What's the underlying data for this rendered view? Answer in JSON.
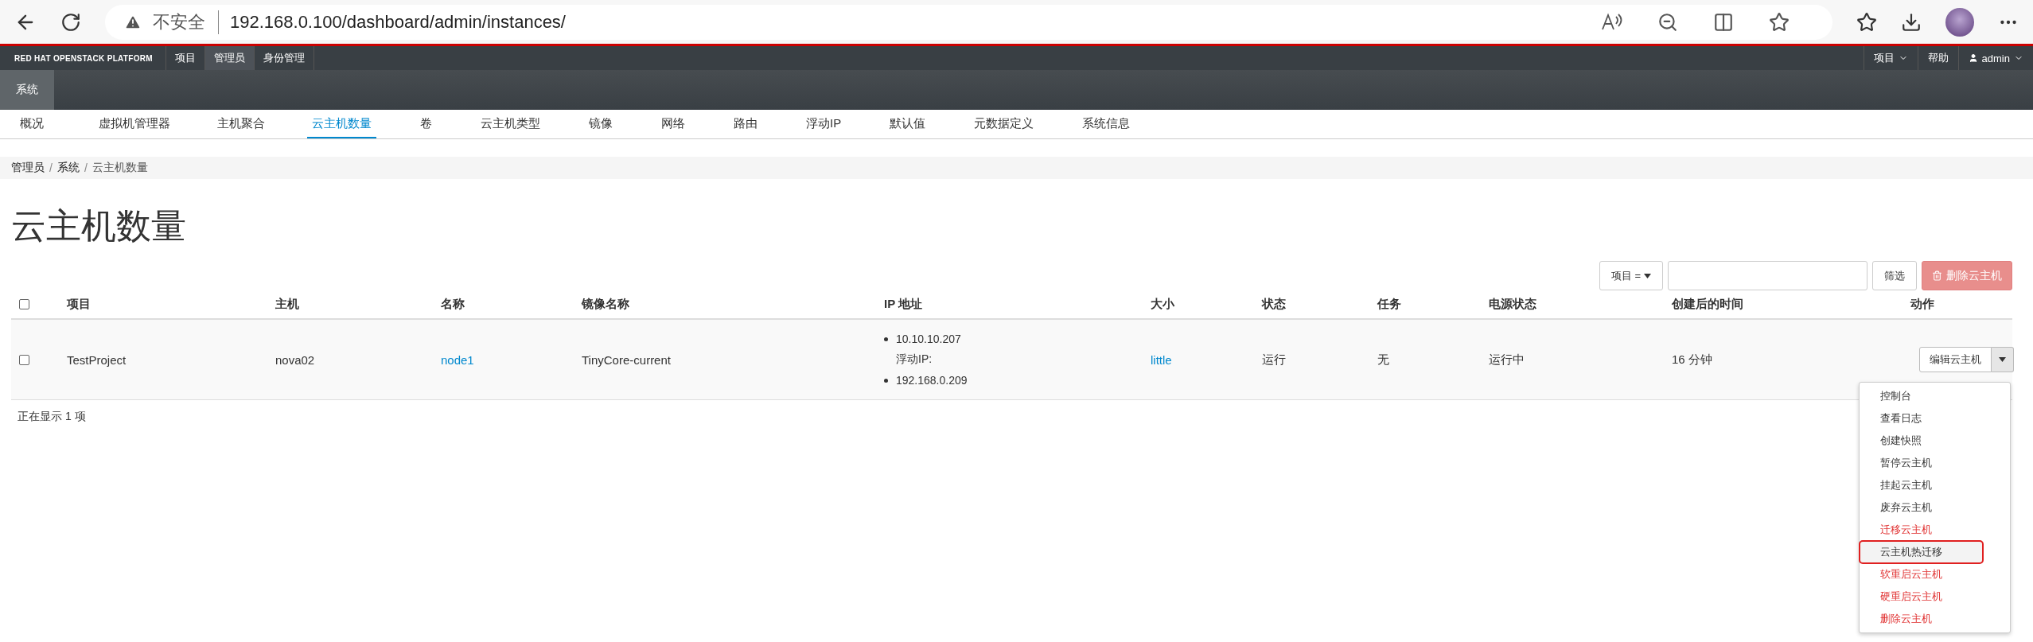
{
  "browser": {
    "security": "不安全",
    "url": "192.168.0.100/dashboard/admin/instances/"
  },
  "top_nav": {
    "logo": "RED HAT OPENSTACK PLATFORM",
    "tabs": [
      {
        "label": "项目",
        "selected": false
      },
      {
        "label": "管理员",
        "selected": true
      },
      {
        "label": "身份管理",
        "selected": false
      }
    ],
    "right": [
      {
        "label": "项目",
        "kind": "dropdown"
      },
      {
        "label": "帮助",
        "kind": "link"
      },
      {
        "label": "admin",
        "kind": "user"
      }
    ]
  },
  "section_tabs": [
    {
      "label": "系统",
      "selected": true
    }
  ],
  "sub_nav": [
    {
      "label": "概况",
      "selected": false
    },
    {
      "label": "虚拟机管理器",
      "selected": false
    },
    {
      "label": "主机聚合",
      "selected": false
    },
    {
      "label": "云主机数量",
      "selected": true
    },
    {
      "label": "卷",
      "selected": false
    },
    {
      "label": "云主机类型",
      "selected": false
    },
    {
      "label": "镜像",
      "selected": false
    },
    {
      "label": "网络",
      "selected": false
    },
    {
      "label": "路由",
      "selected": false
    },
    {
      "label": "浮动IP",
      "selected": false
    },
    {
      "label": "默认值",
      "selected": false
    },
    {
      "label": "元数据定义",
      "selected": false
    },
    {
      "label": "系统信息",
      "selected": false
    }
  ],
  "breadcrumb": [
    {
      "label": "管理员",
      "separator": "/"
    },
    {
      "label": "系统",
      "separator": "/"
    },
    {
      "label": "云主机数量"
    }
  ],
  "page_title": "云主机数量",
  "filter": {
    "field": "项目 =",
    "button": "筛选",
    "delete": "删除云主机"
  },
  "table": {
    "select_all_checked": false,
    "columns": [
      "项目",
      "主机",
      "名称",
      "镜像名称",
      "IP 地址",
      "大小",
      "状态",
      "任务",
      "电源状态",
      "创建后的时间",
      "动作"
    ],
    "rows": [
      {
        "checked": false,
        "project": "TestProject",
        "host": "nova02",
        "name": "node1",
        "image": "TinyCore-current",
        "ip": "10.10.10.207",
        "floating_label": "浮动IP:",
        "floating_ip": "192.168.0.209",
        "size": "little",
        "status": "运行",
        "task": "无",
        "power": "运行中",
        "age": "16 分钟",
        "action": "编辑云主机"
      }
    ],
    "footer": "正在显示 1 项"
  },
  "action_menu": [
    {
      "label": "控制台",
      "danger": false,
      "highlighted": false
    },
    {
      "label": "查看日志",
      "danger": false,
      "highlighted": false
    },
    {
      "label": "创建快照",
      "danger": false,
      "highlighted": false
    },
    {
      "label": "暂停云主机",
      "danger": false,
      "highlighted": false
    },
    {
      "label": "挂起云主机",
      "danger": false,
      "highlighted": false
    },
    {
      "label": "废弃云主机",
      "danger": false,
      "highlighted": false
    },
    {
      "label": "迁移云主机",
      "danger": true,
      "highlighted": false
    },
    {
      "label": "云主机热迁移",
      "danger": false,
      "highlighted": true
    },
    {
      "label": "软重启云主机",
      "danger": true,
      "highlighted": false
    },
    {
      "label": "硬重启云主机",
      "danger": true,
      "highlighted": false
    },
    {
      "label": "删除云主机",
      "danger": true,
      "highlighted": false
    }
  ]
}
